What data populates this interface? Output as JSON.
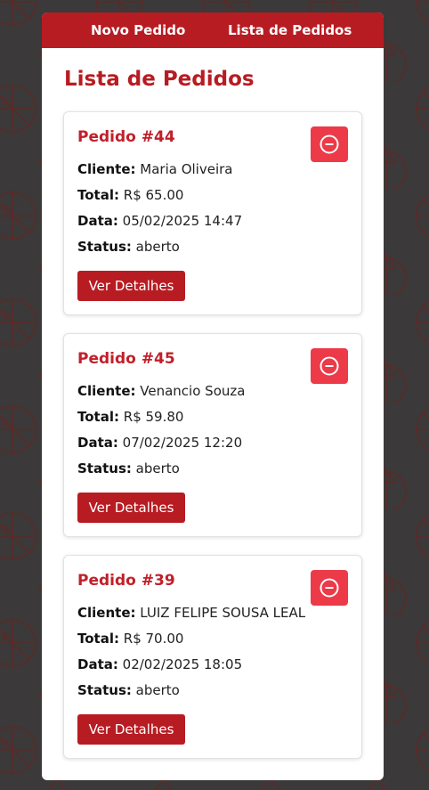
{
  "nav": {
    "items": [
      {
        "label": "Novo Pedido"
      },
      {
        "label": "Lista de Pedidos"
      }
    ]
  },
  "page": {
    "title": "Lista de Pedidos"
  },
  "labels": {
    "cliente": "Cliente:",
    "total": "Total:",
    "data": "Data:",
    "status": "Status:",
    "details_button": "Ver Detalhes"
  },
  "orders": [
    {
      "title": "Pedido #44",
      "cliente": "Maria Oliveira",
      "total": "R$ 65.00",
      "data": "05/02/2025 14:47",
      "status": "aberto"
    },
    {
      "title": "Pedido #45",
      "cliente": "Venancio Souza",
      "total": "R$ 59.80",
      "data": "07/02/2025 12:20",
      "status": "aberto"
    },
    {
      "title": "Pedido #39",
      "cliente": "LUIZ FELIPE SOUSA LEAL",
      "total": "R$ 70.00",
      "data": "02/02/2025 18:05",
      "status": "aberto"
    }
  ],
  "icons": {
    "remove": "minus-circle-icon"
  },
  "colors": {
    "brand": "#b71c22",
    "remove_button": "#ec3a48",
    "background": "#3b3939"
  }
}
